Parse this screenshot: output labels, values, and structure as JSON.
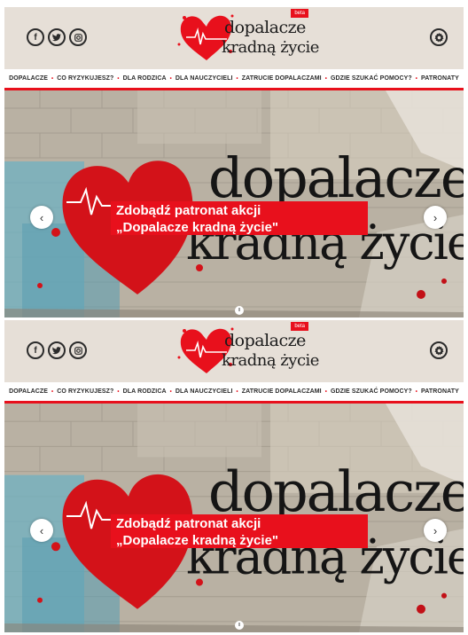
{
  "header": {
    "beta_label": "beta",
    "logo_line1": "dopalacze",
    "logo_line2": "kradną życie",
    "social_icons": [
      "facebook-icon",
      "twitter-icon",
      "instagram-icon"
    ],
    "settings_icon": "gear-icon"
  },
  "nav": {
    "items": [
      "DOPALACZE",
      "CO RYZYKUJESZ?",
      "DLA RODZICA",
      "DLA NAUCZYCIELI",
      "ZATRUCIE DOPALACZAMI",
      "GDZIE SZUKAĆ POMOCY?",
      "PATRONATY"
    ]
  },
  "banner": {
    "cta_line1": "Zdobądź patronat akcji",
    "cta_line2": "„Dopalacze kradną życie\"",
    "background_text_1": "dopalacze",
    "background_text_2": "kradną życie",
    "prev_icon": "chevron-left-icon",
    "next_icon": "chevron-right-icon",
    "pause_icon": "pause-icon"
  },
  "colors": {
    "accent": "#e8101c",
    "header_bg": "#e6dfd7",
    "text": "#1c1c1c"
  }
}
